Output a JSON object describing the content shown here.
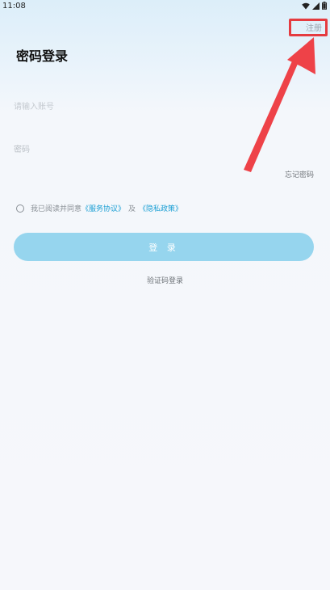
{
  "status_bar": {
    "time": "11:08",
    "icons": [
      "wifi-icon",
      "signal-icon",
      "battery-icon"
    ]
  },
  "header": {
    "register_label": "注册",
    "title": "密码登录"
  },
  "form": {
    "account_placeholder": "请输入账号",
    "password_placeholder": "密码",
    "forgot_label": "忘记密码"
  },
  "agreement": {
    "prefix": "我已阅读并同意",
    "service_link": "《服务协议》",
    "conjunction": "及",
    "privacy_link": "《隐私政策》"
  },
  "login_button_label": "登 录",
  "sms_login_label": "验证码登录",
  "colors": {
    "accent": "#1a9fd4",
    "button": "#96d5ee",
    "highlight": "#e53b40"
  }
}
